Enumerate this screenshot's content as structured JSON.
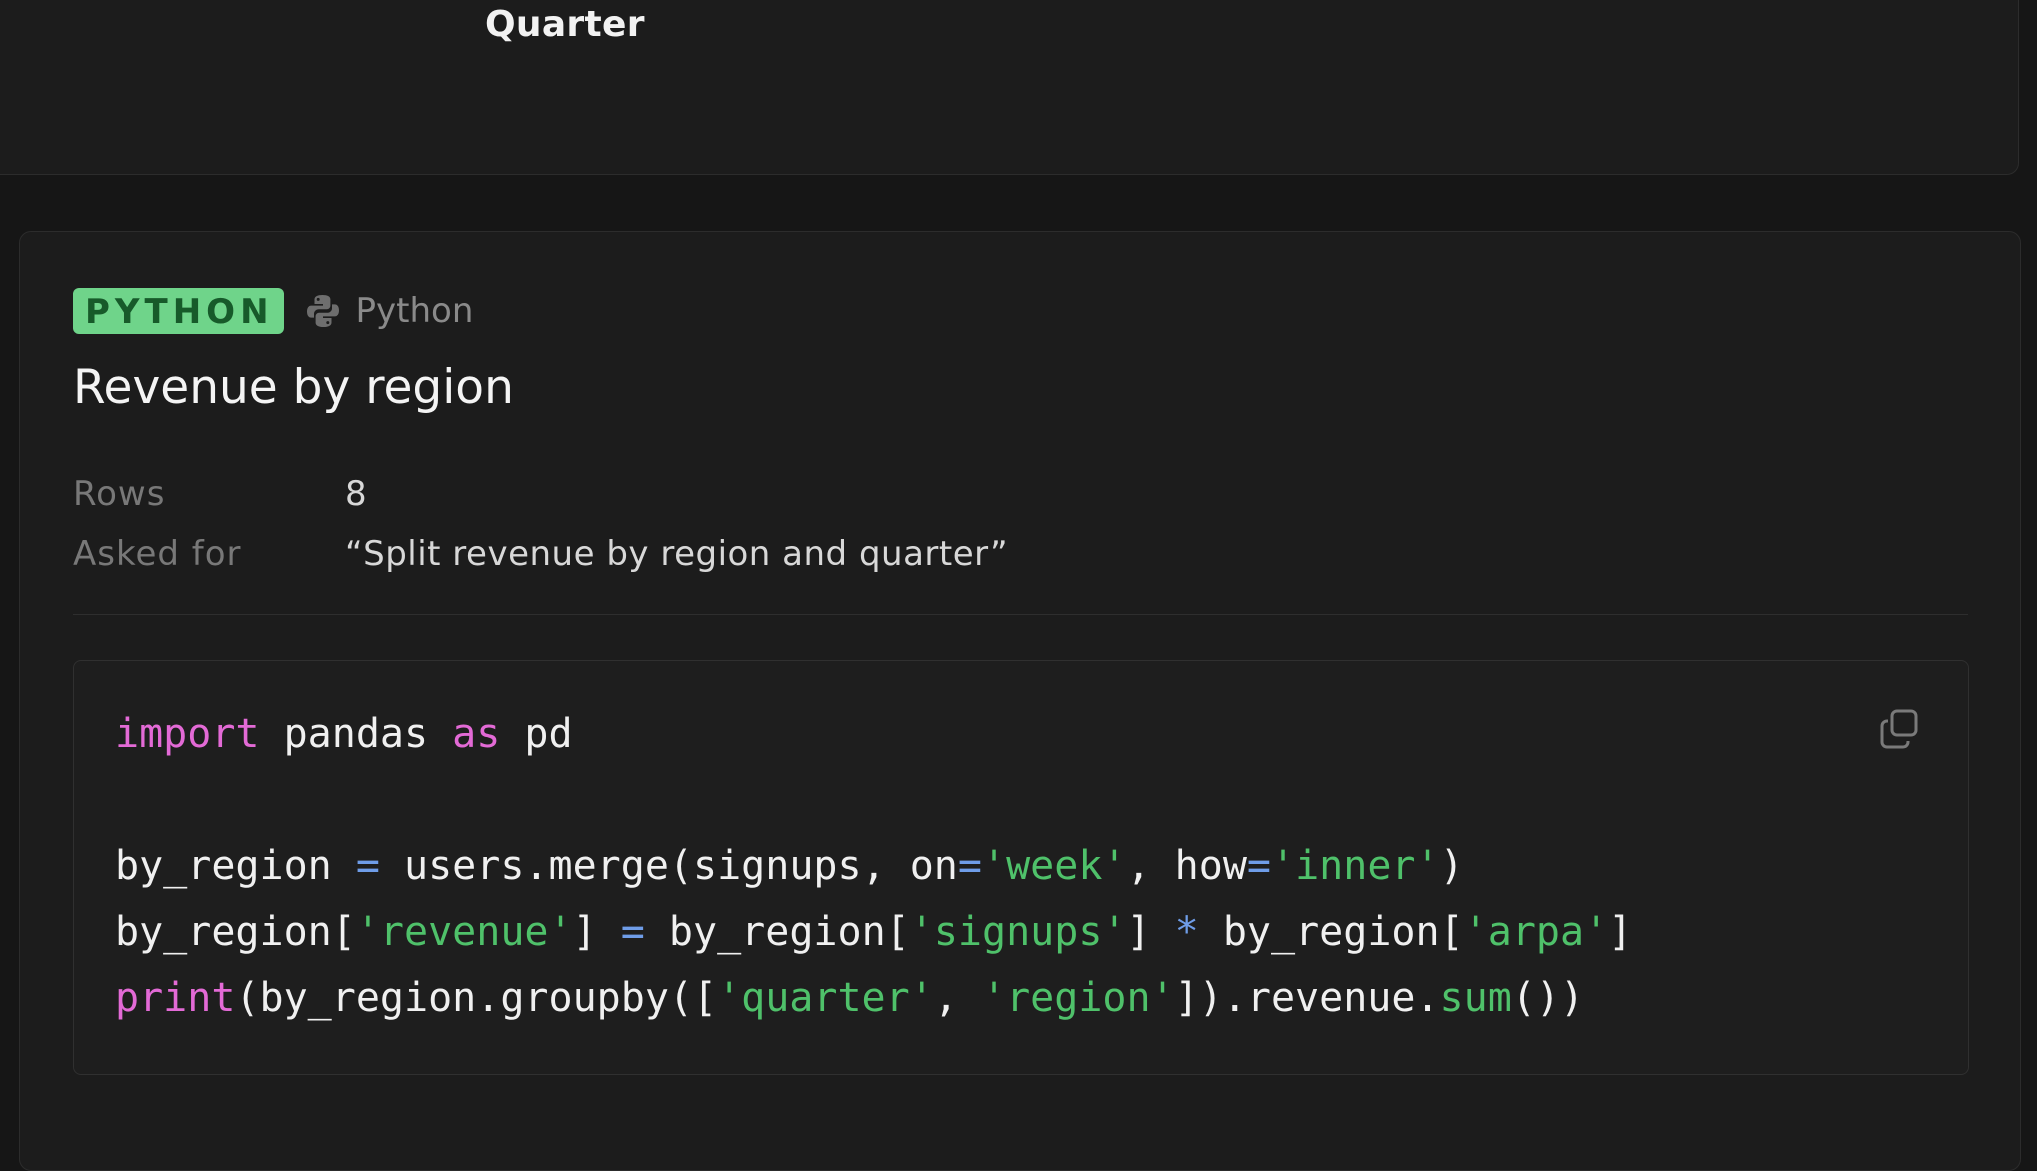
{
  "top_card": {
    "label": "Quarter"
  },
  "cell": {
    "badge": "PYTHON",
    "language": "Python",
    "title": "Revenue by region",
    "meta": [
      {
        "key": "Rows",
        "value": "8"
      },
      {
        "key": "Asked for",
        "value": "“Split revenue by region and quarter”"
      }
    ],
    "code": {
      "line1": {
        "kw1": "import",
        "t1": " pandas ",
        "kw2": "as",
        "t2": " pd"
      },
      "line3": {
        "t1": "by_region ",
        "op1": "=",
        "t2": " users.merge(signups, on",
        "op2": "=",
        "s1": "'week'",
        "t3": ", how",
        "op3": "=",
        "s2": "'inner'",
        "t4": ")"
      },
      "line4": {
        "t1": "by_region[",
        "s1": "'revenue'",
        "t2": "] ",
        "op1": "=",
        "t3": " by_region[",
        "s2": "'signups'",
        "t4": "] ",
        "op2": "*",
        "t5": " by_region[",
        "s3": "'arpa'",
        "t6": "]"
      },
      "line5": {
        "kw1": "print",
        "t1": "(by_region.groupby([",
        "s1": "'quarter'",
        "t2": ", ",
        "s2": "'region'",
        "t3": "]).revenue.",
        "fn1": "sum",
        "t4": "())"
      }
    },
    "copy_icon": "copy-icon"
  },
  "colors": {
    "badge_bg": "#6fd48a",
    "keyword": "#e36ad6",
    "string": "#4fc16a",
    "operator": "#6f9de8"
  }
}
